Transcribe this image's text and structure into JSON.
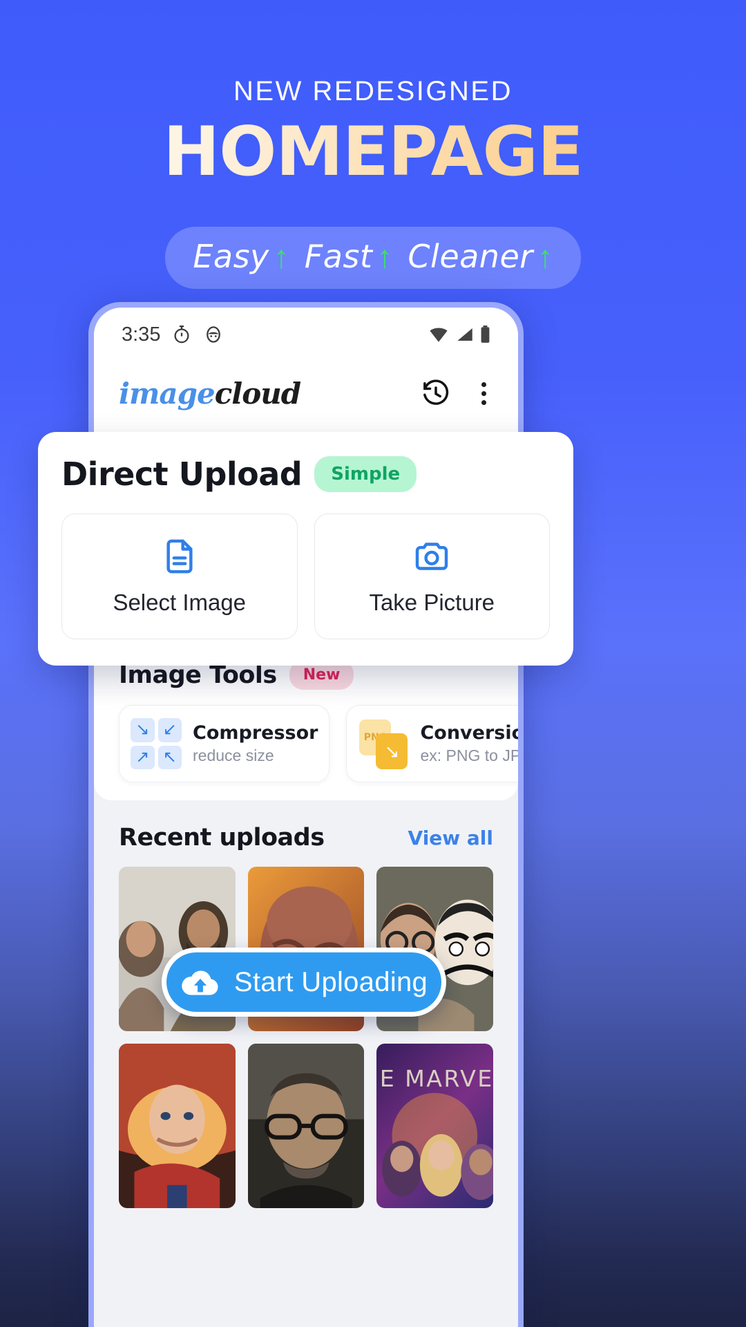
{
  "hero": {
    "kicker": "NEW REDESIGNED",
    "title": "HOMEPAGE",
    "pill": [
      {
        "word": "Easy",
        "arrow": "↑"
      },
      {
        "word": "Fast",
        "arrow": "↑"
      },
      {
        "word": "Cleaner",
        "arrow": "↑"
      }
    ]
  },
  "colors": {
    "background_top": "#3f5cfb",
    "background_bottom": "#1d2344",
    "accent_blue": "#2f9bf0",
    "logo_blue": "#4a90e8",
    "badge_simple_bg": "#b6f5d2",
    "badge_simple_text": "#0fa463",
    "badge_new_bg": "#fbd9e0",
    "badge_new_text": "#e1225a",
    "arrow_green": "#3ce06a",
    "title_gradient_start": "#ffffff",
    "title_gradient_end": "#f9bf6d"
  },
  "phone": {
    "statusbar": {
      "time": "3:35",
      "icons_left": [
        "stopwatch-icon",
        "face-icon"
      ],
      "icons_right": [
        "wifi-icon",
        "signal-icon",
        "battery-icon"
      ]
    },
    "appbar": {
      "logo_part1": "image",
      "logo_part2": "cloud",
      "actions": [
        "history-icon",
        "overflow-menu-icon"
      ]
    },
    "direct_upload": {
      "title": "Direct Upload",
      "badge": "Simple",
      "buttons": [
        {
          "label": "Select Image",
          "icon": "document-icon"
        },
        {
          "label": "Take Picture",
          "icon": "camera-icon"
        }
      ]
    },
    "image_tools": {
      "title": "Image Tools",
      "badge": "New",
      "cards": [
        {
          "title": "Compressor",
          "subtitle": "reduce size",
          "icon": "compress-arrows-icon"
        },
        {
          "title": "Conversion",
          "subtitle": "ex: PNG to JPG",
          "icon": "png-convert-icon",
          "icon_label": "PNG"
        }
      ]
    },
    "recent": {
      "title": "Recent uploads",
      "view_all": "View all",
      "thumbnails": [
        {
          "name": "poster-kalki"
        },
        {
          "name": "poster-thanos"
        },
        {
          "name": "poster-money-heist"
        },
        {
          "name": "poster-captain-marvel"
        },
        {
          "name": "poster-breaking-bad"
        },
        {
          "name": "poster-the-marvels",
          "caption": "THE MARVELS"
        }
      ]
    },
    "cta": {
      "label": "Start Uploading",
      "icon": "cloud-upload-icon"
    }
  }
}
